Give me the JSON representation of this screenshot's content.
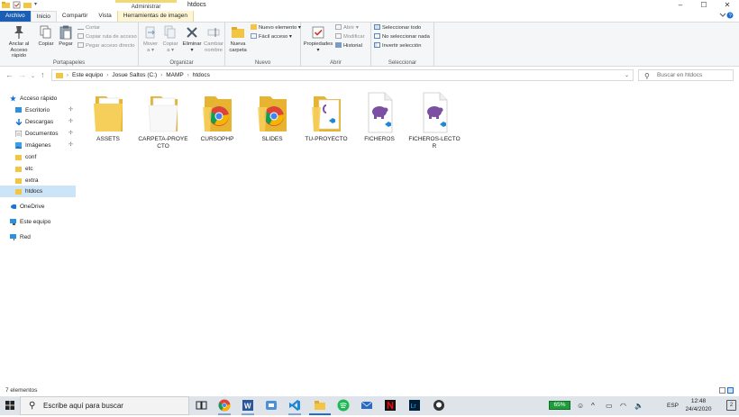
{
  "window": {
    "title": "htdocs",
    "context_group": "Administrar",
    "controls": [
      "–",
      "☐",
      "✕"
    ]
  },
  "tabs": [
    {
      "label": "Archivo"
    },
    {
      "label": "Inicio"
    },
    {
      "label": "Compartir"
    },
    {
      "label": "Vista"
    },
    {
      "label": "Herramientas de imagen"
    }
  ],
  "ribbon": {
    "clipboard": {
      "group_label": "Portapapeles",
      "pin_label_1": "Anclar al",
      "pin_label_2": "Acceso rápido",
      "copy": "Copiar",
      "paste": "Pegar",
      "cut": "Cortar",
      "copy_path": "Copiar ruta de acceso",
      "paste_shortcut": "Pegar acceso directo"
    },
    "organize": {
      "group_label": "Organizar",
      "move_1": "Mover",
      "move_2": "a ▾",
      "copy_1": "Copiar",
      "copy_2": "a ▾",
      "delete_1": "Eliminar",
      "delete_2": "▾",
      "rename_1": "Cambiar",
      "rename_2": "nombre"
    },
    "new": {
      "group_label": "Nuevo",
      "new_folder_1": "Nueva",
      "new_folder_2": "carpeta",
      "new_item": "Nuevo elemento ▾",
      "easy_access": "Fácil acceso ▾"
    },
    "open": {
      "group_label": "Abrir",
      "properties_1": "Propiedades",
      "properties_2": "▾",
      "open": "Abrir ▾",
      "edit": "Modificar",
      "history": "Historial"
    },
    "select": {
      "group_label": "Seleccionar",
      "select_all": "Seleccionar todo",
      "select_none": "No seleccionar nada",
      "invert": "Invertir selección"
    }
  },
  "address": {
    "crumbs": [
      "Este equipo",
      "Josue Saltos (C:)",
      "MAMP",
      "htdocs"
    ],
    "search_placeholder": "Buscar en htdocs"
  },
  "sidebar": {
    "items": [
      {
        "label": "Acceso rápido",
        "icon": "star-icon",
        "pinned": false
      },
      {
        "label": "Escritorio",
        "icon": "desktop-icon",
        "pinned": true
      },
      {
        "label": "Descargas",
        "icon": "download-icon",
        "pinned": true
      },
      {
        "label": "Documentos",
        "icon": "document-icon",
        "pinned": true
      },
      {
        "label": "Imágenes",
        "icon": "image-icon",
        "pinned": true
      },
      {
        "label": "conf",
        "icon": "folder-icon",
        "pinned": false
      },
      {
        "label": "etc",
        "icon": "folder-icon",
        "pinned": false
      },
      {
        "label": "extra",
        "icon": "folder-icon",
        "pinned": false
      },
      {
        "label": "htdocs",
        "icon": "folder-icon",
        "pinned": false,
        "selected": true
      },
      {
        "label": "OneDrive",
        "icon": "cloud-icon",
        "pinned": false
      },
      {
        "label": "Este equipo",
        "icon": "computer-icon",
        "pinned": false
      },
      {
        "label": "Red",
        "icon": "network-icon",
        "pinned": false
      }
    ],
    "pin_glyph": "📌"
  },
  "files": [
    {
      "name": "ASSETS",
      "kind": "folder"
    },
    {
      "name": "CARPETA-PROYECTO",
      "kind": "folder-empty"
    },
    {
      "name": "CURSOPHP",
      "kind": "folder-chrome"
    },
    {
      "name": "SLIDES",
      "kind": "folder-chrome"
    },
    {
      "name": "TU-PROYECTO",
      "kind": "folder-vscode"
    },
    {
      "name": "FICHEROS",
      "kind": "php-file"
    },
    {
      "name": "FICHEROS-LECTOR",
      "kind": "php-file"
    }
  ],
  "status": {
    "count": "7 elementos"
  },
  "taskbar": {
    "search_placeholder": "Escribe aquí para buscar",
    "battery": "65%",
    "language": "ESP",
    "time": "12:48",
    "date": "24/4/2020",
    "notifications": "2",
    "apps": [
      "task-view-icon",
      "chrome-icon",
      "word-icon",
      "teams-icon",
      "vscode-icon",
      "explorer-icon",
      "spotify-icon",
      "mail-icon",
      "netflix-icon",
      "lightroom-icon",
      "github-icon"
    ]
  },
  "colors": {
    "accent": "#1a5fb4",
    "selection": "#cce4f7",
    "folder": "#f4c542",
    "php_purple": "#7b4fa2",
    "vscode_blue": "#1f88d6"
  }
}
